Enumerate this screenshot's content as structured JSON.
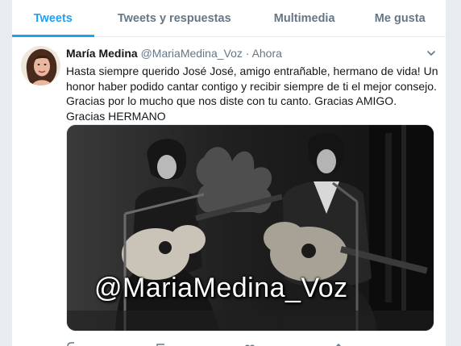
{
  "tabs": [
    {
      "label": "Tweets"
    },
    {
      "label": "Tweets y respuestas"
    },
    {
      "label": "Multimedia"
    },
    {
      "label": "Me gusta"
    }
  ],
  "tweet": {
    "author_name": "María Medina",
    "author_handle": "@MariaMedina_Voz",
    "separator": "·",
    "time": "Ahora",
    "text": "Hasta siempre querido José José, amigo entrañable, hermano de vida! Un honor haber podido cantar contigo y recibir siempre de ti el mejor consejo. Gracias por lo mucho que nos diste con tu canto. Gracias AMIGO. Gracias HERMANO",
    "media": {
      "watermark": "@MariaMedina_Voz",
      "description_icon": "photo-icon"
    }
  },
  "icons": {
    "caret": "chevron-down-icon",
    "actions": [
      "reply-icon",
      "retweet-icon",
      "like-icon",
      "share-icon"
    ]
  },
  "colors": {
    "accent": "#1da1f2",
    "text": "#14171a",
    "muted": "#657786",
    "border": "#e6ecf0"
  }
}
